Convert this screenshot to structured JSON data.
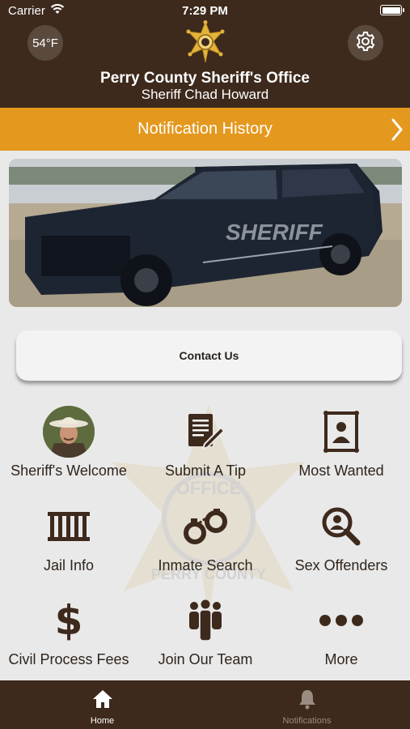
{
  "status": {
    "carrier": "Carrier",
    "time": "7:29 PM"
  },
  "header": {
    "temperature": "54°F",
    "title": "Perry County Sheriff's Office",
    "subtitle": "Sheriff Chad Howard"
  },
  "notification_bar": {
    "label": "Notification History"
  },
  "hero": {
    "vehicle_text": "SHERIFF"
  },
  "contact": {
    "label": "Contact Us"
  },
  "watermark": {
    "text_top": "OFFICE",
    "text_bottom": "PERRY COUNTY"
  },
  "grid": [
    {
      "label": "Sheriff's Welcome",
      "icon": "sheriff-photo"
    },
    {
      "label": "Submit A Tip",
      "icon": "document-pen-icon"
    },
    {
      "label": "Most Wanted",
      "icon": "wanted-poster-icon"
    },
    {
      "label": "Jail Info",
      "icon": "jail-bars-icon"
    },
    {
      "label": "Inmate Search",
      "icon": "handcuffs-icon"
    },
    {
      "label": "Sex Offenders",
      "icon": "person-search-icon"
    },
    {
      "label": "Civil Process Fees",
      "icon": "dollar-icon"
    },
    {
      "label": "Join Our Team",
      "icon": "group-icon"
    },
    {
      "label": "More",
      "icon": "ellipsis-icon"
    }
  ],
  "tabs": [
    {
      "label": "Home",
      "icon": "home-icon",
      "active": true
    },
    {
      "label": "Notifications",
      "icon": "bell-icon",
      "active": false
    }
  ],
  "colors": {
    "header": "#3d2a1d",
    "accent": "#e4981d",
    "text_dark": "#2f241c",
    "background": "#e9e9e9"
  }
}
